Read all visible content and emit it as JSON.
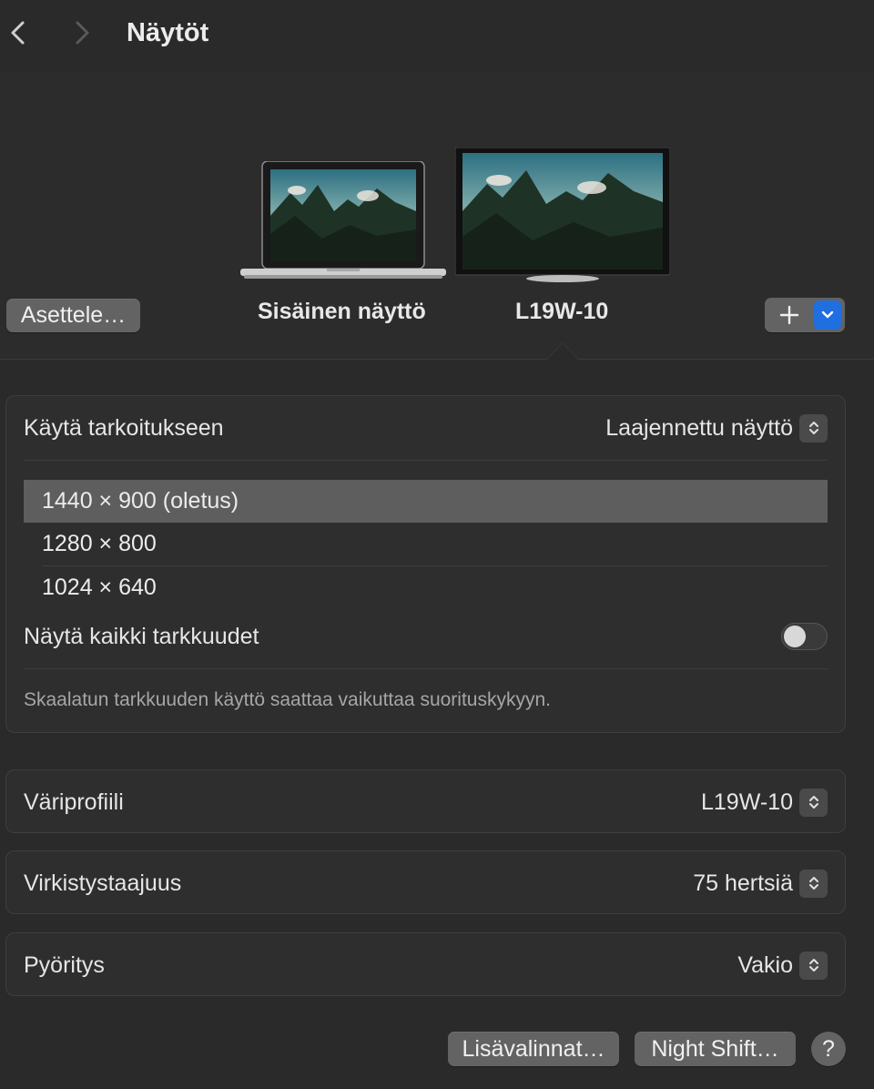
{
  "header": {
    "title": "Näytöt",
    "back_icon": "chevron-left-icon",
    "forward_icon": "chevron-right-icon"
  },
  "displays": {
    "arrange_button": "Asettele…",
    "internal_label": "Sisäinen näyttö",
    "external_label": "L19W-10",
    "selected": "L19W-10",
    "add_icon": "plus-icon",
    "dropdown_icon": "chevron-down-icon"
  },
  "main_card": {
    "use_as_label": "Käytä tarkoitukseen",
    "use_as_value": "Laajennettu näyttö",
    "resolutions": [
      {
        "label": "1440 × 900 (oletus)",
        "selected": true
      },
      {
        "label": "1280 × 800",
        "selected": false
      },
      {
        "label": "1024 × 640",
        "selected": false
      }
    ],
    "show_all_label": "Näytä kaikki tarkkuudet",
    "show_all_on": false,
    "note": "Skaalatun tarkkuuden käyttö saattaa vaikuttaa suorituskykyyn."
  },
  "color_profile": {
    "label": "Väriprofiili",
    "value": "L19W-10"
  },
  "refresh_rate": {
    "label": "Virkistystaajuus",
    "value": "75 hertsiä"
  },
  "rotation": {
    "label": "Pyöritys",
    "value": "Vakio"
  },
  "footer": {
    "advanced_button": "Lisävalinnat…",
    "night_shift_button": "Night Shift…",
    "help_label": "?"
  },
  "colors": {
    "background": "#2a2a2a",
    "accent": "#1f6fe0",
    "selected_row": "#5e5e5e",
    "button": "#636363"
  }
}
